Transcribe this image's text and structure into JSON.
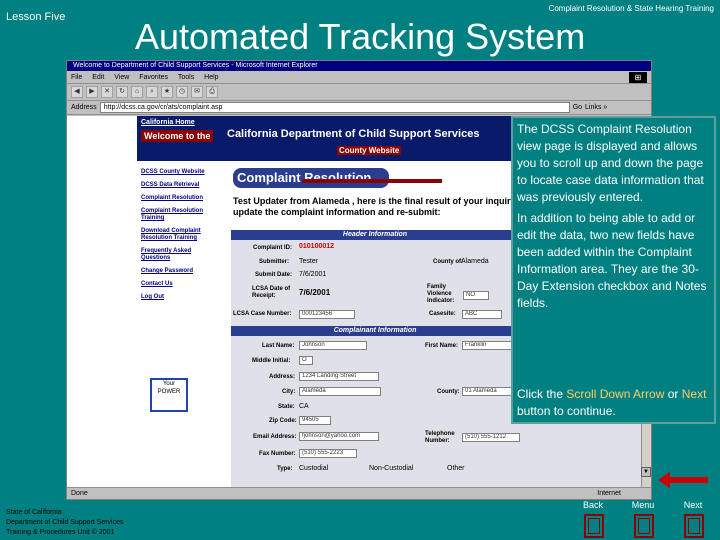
{
  "slide": {
    "lesson": "Lesson Five",
    "course": "Complaint Resolution & State Hearing Training",
    "title": "Automated Tracking System"
  },
  "browser": {
    "title": "Welcome to Department of Child Support Services - Microsoft Internet Explorer",
    "menu": [
      "File",
      "Edit",
      "View",
      "Favorites",
      "Tools",
      "Help"
    ],
    "address_label": "Address",
    "address_value": "http://dcss.ca.gov/cr/ats/complaint.asp",
    "go_label": "Go",
    "links_label": "Links »",
    "status_text": "Done",
    "zone_text": "Internet"
  },
  "site": {
    "home_link": "California Home",
    "welcome": "Welcome to the",
    "department": "California Department of Child Support Services",
    "county": "County Website",
    "nav": [
      "DCSS County Website",
      "DCSS Data Retrieval",
      "Complaint Resolution",
      "Complaint Resolution Training",
      "Download Complaint Resolution Training",
      "Frequently Asked Questions",
      "Change Password",
      "Contact Us",
      "Log Out"
    ],
    "poster_text": "Your POWER",
    "banner": "Complaint Resolution",
    "intro": "Test Updater from Alameda , here is the final result of your inquiry. update the complaint information and re-submit:",
    "header_info": "Header Information",
    "complainant_info": "Complainant Information"
  },
  "form": {
    "complaint_id_label": "Complaint ID:",
    "complaint_id": "010100012",
    "submitter_label": "Submitter:",
    "submitter": "Tester",
    "county_of_label": "County of:",
    "county_of": "Alameda",
    "submit_date_label": "Submit Date:",
    "submit_date": "7/6/2001",
    "lcsa_date_label": "LCSA Date of Receipt:",
    "lcsa_date": "7/6/2001",
    "family_violence_label": "Family Violence Indicator:",
    "family_violence": "NO",
    "lcsa_case_label": "LCSA Case Number:",
    "lcsa_case": "000123456",
    "casesite_label": "Casesite:",
    "casesite": "ABC",
    "last_name_label": "Last Name:",
    "last_name": "Johnson",
    "first_name_label": "First Name:",
    "first_name": "Franklin",
    "middle_initial_label": "Middle Initial:",
    "middle_initial": "O",
    "address_label": "Address:",
    "address": "1234 Landing Street",
    "city_label": "City:",
    "city": "Alameda",
    "county_label": "County:",
    "county": "01 Alameda",
    "state_label": "State:",
    "state": "CA",
    "zip_label": "Zip Code:",
    "zip": "94505",
    "email_label": "Email Address:",
    "email": "fjohnson@yahoo.com",
    "telephone_label": "Telephone Number:",
    "telephone": "(510) 555-1212",
    "fax_label": "Fax Number:",
    "fax": "(510) 555-2223",
    "type_label": "Type:",
    "type_custodial": "Custodial",
    "type_noncustodial": "Non-Custodial",
    "type_other": "Other"
  },
  "callout": {
    "paragraph1": "The DCSS Complaint Resolution view page is displayed and allows you to scroll up and down the page to locate case data information that was previously entered.",
    "paragraph2": "In addition to being able to add or edit the data, two new fields have been added within the Complaint Information area.  They are the 30-Day Extension checkbox and Notes fields.",
    "instr_prefix": "Click the ",
    "instr_scroll": "Scroll Down Arrow",
    "instr_mid": " or ",
    "instr_next": "Next",
    "instr_suffix": " button to continue."
  },
  "footer": {
    "org_line1": "State of California",
    "org_line2": "Department of Child Support Services",
    "org_line3": "Training & Procedures Unit  © 2001",
    "back": "Back",
    "menu": "Menu",
    "next": "Next"
  },
  "colors": {
    "background": "#008080",
    "accent": "#8b0000",
    "highlight": "#ffcc66",
    "site_blue": "#2a3d8f"
  }
}
